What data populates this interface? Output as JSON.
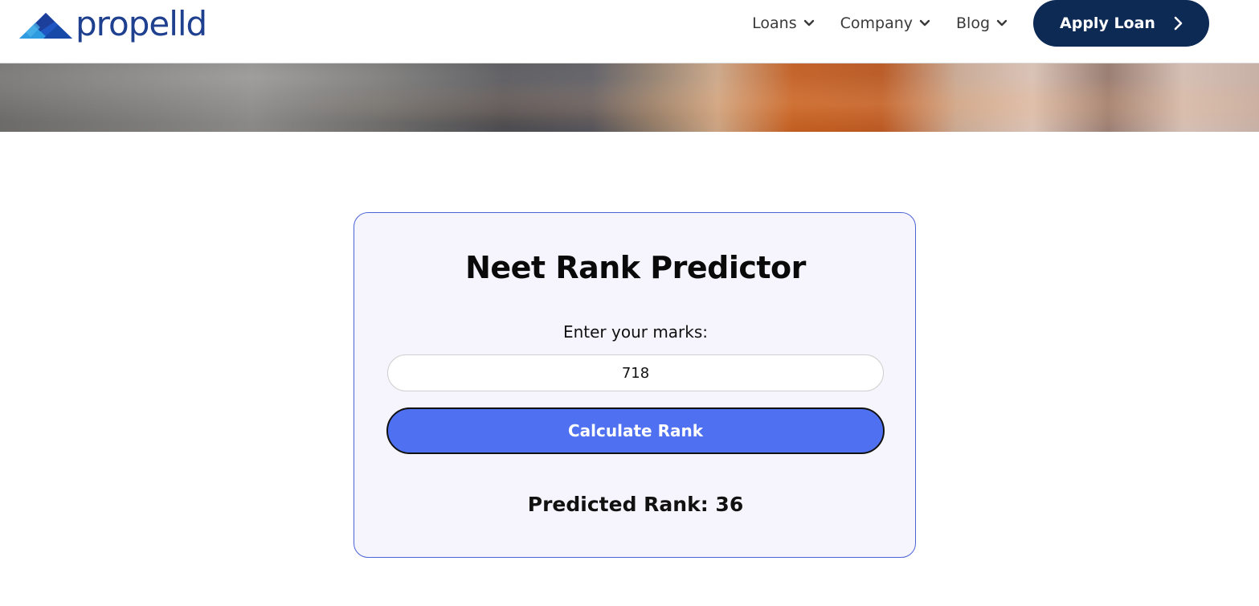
{
  "header": {
    "logo_text": "propelld",
    "nav": [
      {
        "label": "Loans"
      },
      {
        "label": "Company"
      },
      {
        "label": "Blog"
      }
    ],
    "apply_label": "Apply Loan"
  },
  "card": {
    "title": "Neet Rank Predictor",
    "marks_label": "Enter your marks:",
    "marks_value": "718",
    "button_label": "Calculate Rank",
    "result_text": "Predicted Rank: 36"
  },
  "colors": {
    "brand_navy": "#0d2a55",
    "logo_blue": "#1f3f8f",
    "button_blue": "#4f70f0",
    "card_border": "#4b63d6",
    "card_bg": "#f6f5fd"
  },
  "icons": {
    "logo": "propelld-triangle-logo-icon",
    "dropdown": "chevron-down-icon",
    "apply_arrow": "chevron-right-icon"
  }
}
